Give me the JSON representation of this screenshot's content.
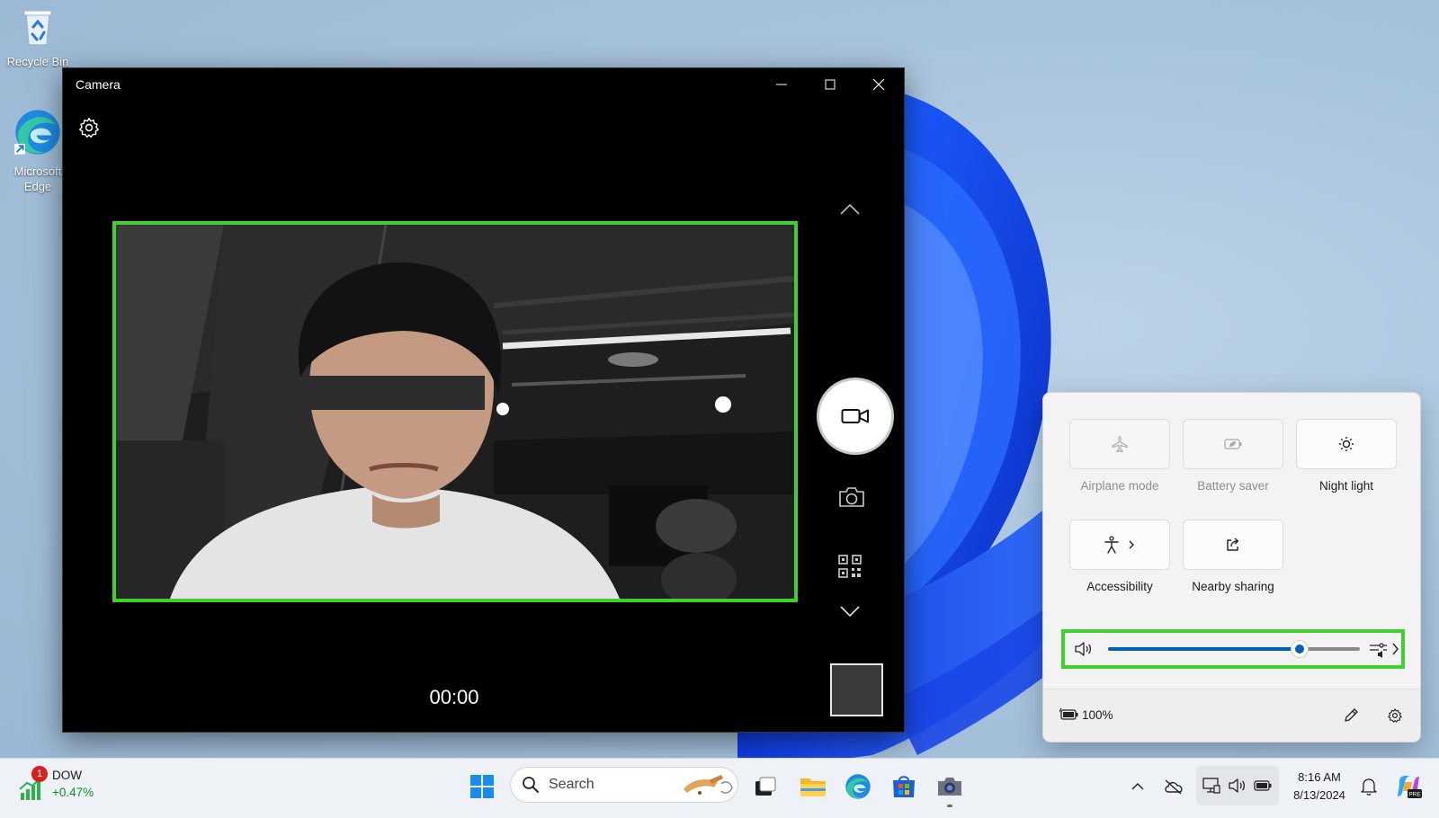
{
  "desktop": {
    "icons": [
      {
        "label": "Recycle Bin"
      },
      {
        "label": "Microsoft Edge"
      }
    ]
  },
  "camera_window": {
    "title": "Camera",
    "timer": "00:00"
  },
  "quick_settings": {
    "tiles": [
      {
        "label": "Airplane mode",
        "state": "disabled"
      },
      {
        "label": "Battery saver",
        "state": "disabled"
      },
      {
        "label": "Night light",
        "state": "off"
      },
      {
        "label": "Accessibility",
        "state": "off"
      },
      {
        "label": "Nearby sharing",
        "state": "off"
      }
    ],
    "volume_level": 0.76,
    "battery": "100%"
  },
  "taskbar": {
    "widget_badge": "1",
    "widget_title": "DOW",
    "widget_value": "+0.47%",
    "search_placeholder": "Search",
    "time": "8:16 AM",
    "date": "8/13/2024"
  },
  "colors": {
    "highlight": "#3fcf2f",
    "accent": "#005fb8"
  }
}
